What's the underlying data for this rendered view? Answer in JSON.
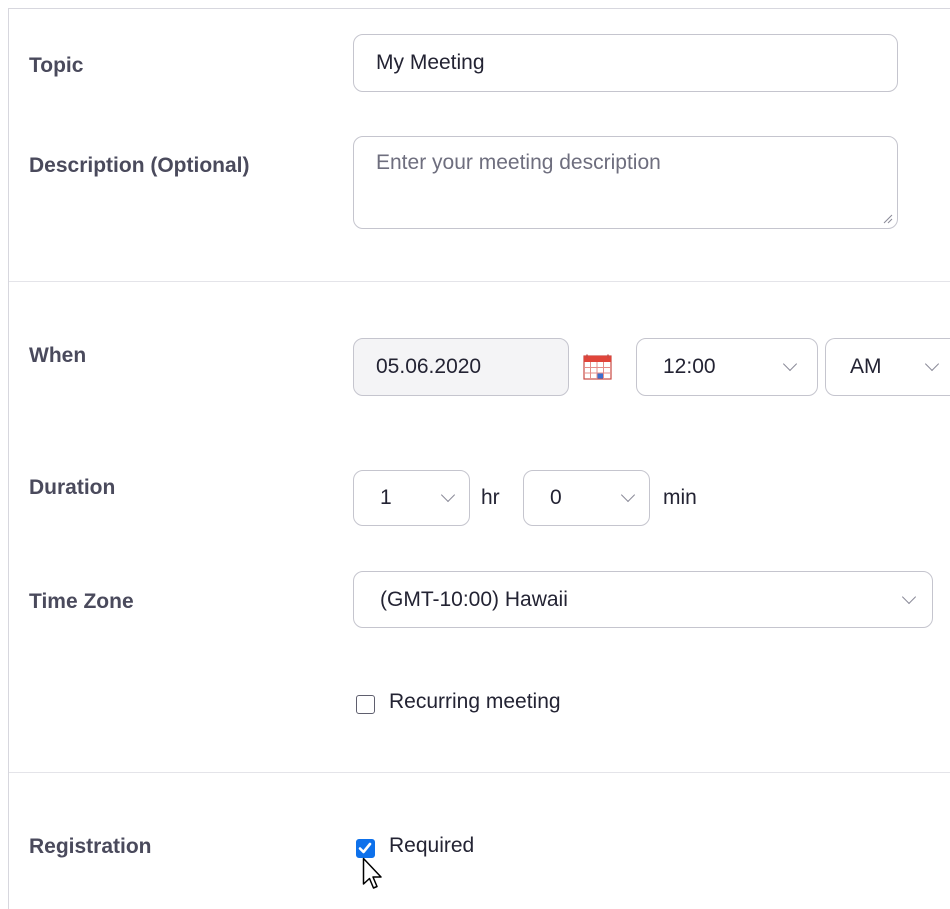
{
  "topic": {
    "label": "Topic",
    "value": "My Meeting"
  },
  "description": {
    "label": "Description (Optional)",
    "placeholder": "Enter your meeting description"
  },
  "when": {
    "label": "When",
    "date": "05.06.2020",
    "time": "12:00",
    "ampm": "AM"
  },
  "duration": {
    "label": "Duration",
    "hours": "1",
    "hours_unit": "hr",
    "minutes": "0",
    "minutes_unit": "min"
  },
  "timezone": {
    "label": "Time Zone",
    "value": "(GMT-10:00) Hawaii"
  },
  "recurring": {
    "label": "Recurring meeting",
    "checked": false
  },
  "registration": {
    "label": "Registration",
    "option_label": "Required",
    "checked": true
  },
  "icons": {
    "calendar": "calendar-icon",
    "chevron": "chevron-down-icon",
    "cursor": "mouse-pointer-icon"
  },
  "colors": {
    "accent": "#0e71eb",
    "calendar": "#e0453a"
  }
}
